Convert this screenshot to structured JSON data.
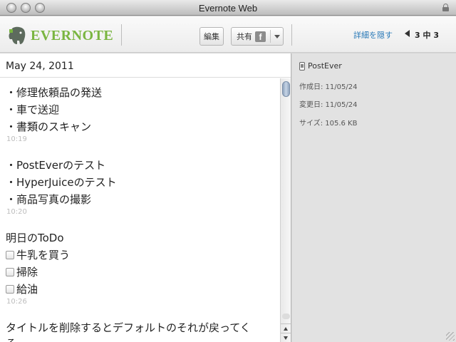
{
  "window": {
    "title": "Evernote Web"
  },
  "toolbar": {
    "logo_text": "EVERNOTE",
    "edit_label": "編集",
    "share_label": "共有",
    "facebook_glyph": "f",
    "hide_details_label": "詳細を隠す",
    "pager": "3 中 3"
  },
  "note": {
    "date": "May 24, 2011",
    "lines": [
      "・修理依頼品の発送",
      "・車で送迎",
      "・書類のスキャン",
      "10:19",
      "・PostEverのテスト",
      "・HyperJuiceのテスト",
      "・商品写真の撮影",
      "10:20",
      "明日のToDo",
      "牛乳を買う",
      "掃除",
      "給油",
      "10:26",
      "タイトルを削除するとデフォルトのそれが戻ってく",
      "る"
    ]
  },
  "info": {
    "source": "PostEver",
    "created": "作成日: 11/05/24",
    "modified": "変更日: 11/05/24",
    "size": "サイズ: 105.6 KB"
  },
  "icons": {
    "logo": "evernote-elephant-icon",
    "facebook": "facebook-icon",
    "dropdown": "chevron-down-icon",
    "previous": "triangle-left-icon",
    "lock": "lock-icon",
    "source": "mobile-phone-icon"
  },
  "colors": {
    "brand_green": "#7ab540",
    "link_blue": "#2a7ab8",
    "timestamp_gray": "#bdbdbd"
  }
}
